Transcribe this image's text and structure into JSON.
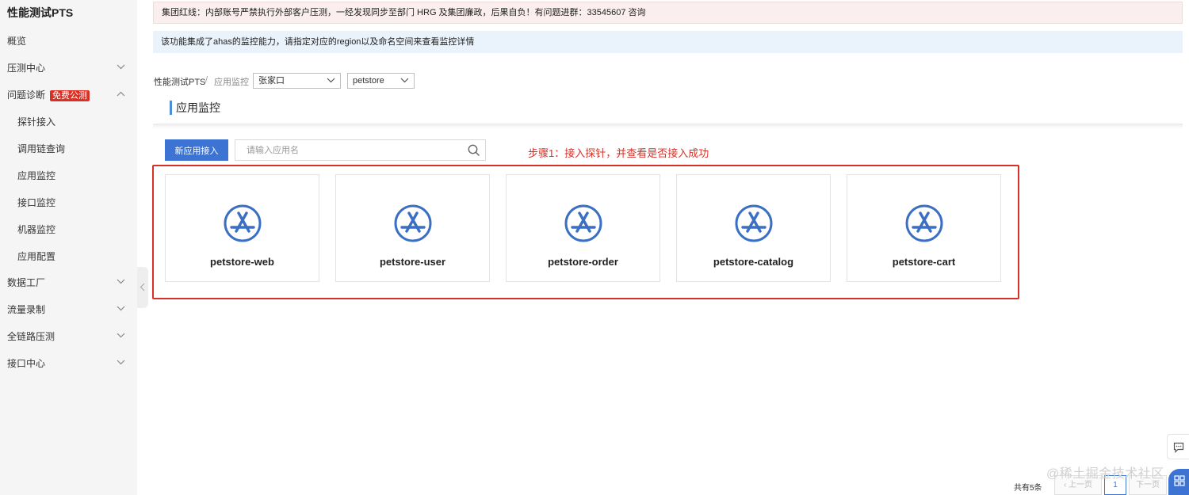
{
  "sidebar": {
    "title": "性能测试PTS",
    "items": [
      {
        "label": "概览"
      },
      {
        "label": "压测中心"
      },
      {
        "label": "问题诊断",
        "badge": "免费公测"
      },
      {
        "label": "探针接入"
      },
      {
        "label": "调用链查询"
      },
      {
        "label": "应用监控"
      },
      {
        "label": "接口监控"
      },
      {
        "label": "机器监控"
      },
      {
        "label": "应用配置"
      },
      {
        "label": "数据工厂"
      },
      {
        "label": "流量录制"
      },
      {
        "label": "全链路压测"
      },
      {
        "label": "接口中心"
      }
    ]
  },
  "banners": {
    "warning": "集团红线：内部账号严禁执行外部客户压测，一经发现同步至部门 HRG 及集团廉政，后果自负！有问题进群：33545607 咨询",
    "info": "该功能集成了ahas的监控能力，请指定对应的region以及命名空间来查看监控详情"
  },
  "breadcrumb": {
    "root": "性能测试PTS",
    "separator": "/",
    "current": "应用监控"
  },
  "filters": {
    "region": "张家口",
    "namespace": "petstore"
  },
  "page_title": "应用监控",
  "toolbar": {
    "new_app_label": "新应用接入",
    "search_placeholder": "请输入应用名"
  },
  "annotation": "步骤1：接入探针，并查看是否接入成功",
  "apps": [
    {
      "name": "petstore-web"
    },
    {
      "name": "petstore-user"
    },
    {
      "name": "petstore-order"
    },
    {
      "name": "petstore-catalog"
    },
    {
      "name": "petstore-cart"
    }
  ],
  "pagination": {
    "total": "共有5条",
    "prev": "上一页",
    "page": "1",
    "next": "下一页"
  },
  "watermark": "@稀土掘金技术社区",
  "colors": {
    "primary": "#3d74d4",
    "annotation_red": "#d93026",
    "app_icon_blue": "#3a6fc4"
  }
}
